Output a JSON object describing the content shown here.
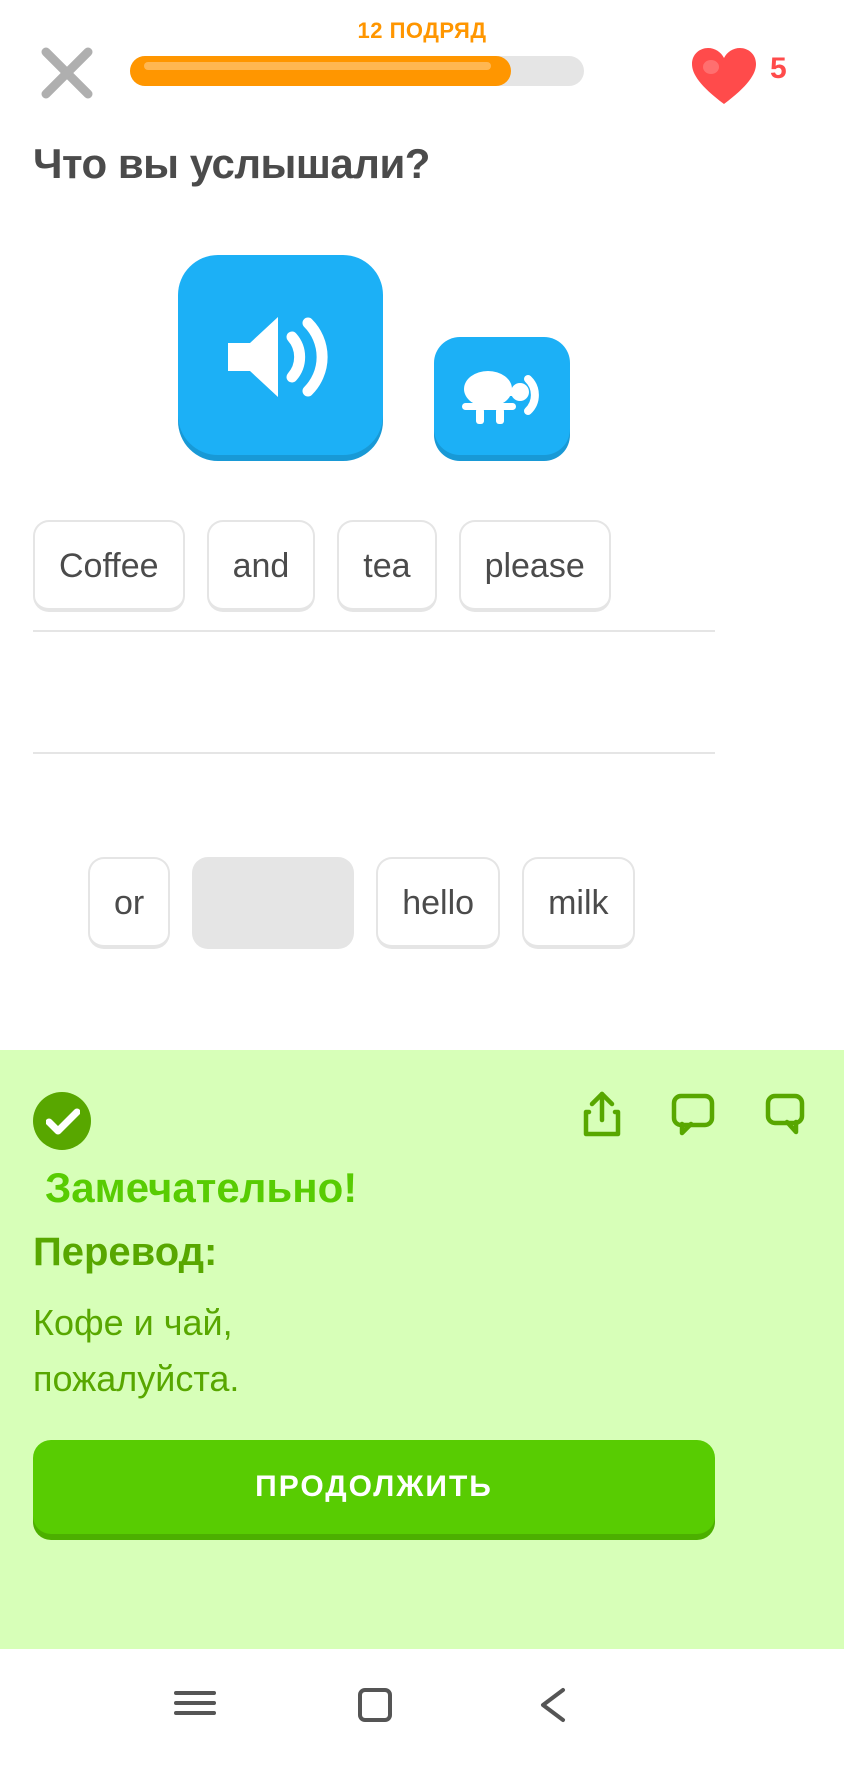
{
  "header": {
    "close_icon": "close-icon",
    "streak_label": "12 ПОДРЯД",
    "progress_percent": 84,
    "heart_icon": "heart-icon",
    "hearts_count": "5",
    "progress_color": "#FF9600",
    "track_color": "#E5E5E5",
    "heart_color": "#FF4B4B"
  },
  "exercise": {
    "question": "Что вы услышали?",
    "speaker_icon": "speaker-icon",
    "speaker_slow_icon": "turtle-speaker-icon",
    "speaker_color": "#1CB0F6",
    "answer_tiles": [
      "Coffee",
      "and",
      "tea",
      "please"
    ],
    "word_bank": [
      {
        "label": "or",
        "used": false
      },
      {
        "label": "",
        "used": true
      },
      {
        "label": "hello",
        "used": false
      },
      {
        "label": "milk",
        "used": false
      }
    ]
  },
  "result": {
    "status": "correct",
    "check_icon": "check-circle-icon",
    "title": "Замечательно!",
    "subtitle": "Перевод:",
    "translation_line_1": "Кофе и чай,",
    "translation_line_2": "пожалуйста.",
    "continue_label": "ПРОДОЛЖИТЬ",
    "panel_color": "#D7FFB8",
    "accent_color": "#58CC02",
    "text_color": "#58A700",
    "icons": [
      {
        "name": "share-icon"
      },
      {
        "name": "comment-icon"
      },
      {
        "name": "report-flag-icon"
      }
    ]
  },
  "navbar": {
    "recent_icon": "recent-apps-icon",
    "home_icon": "home-icon",
    "back_icon": "back-icon"
  }
}
